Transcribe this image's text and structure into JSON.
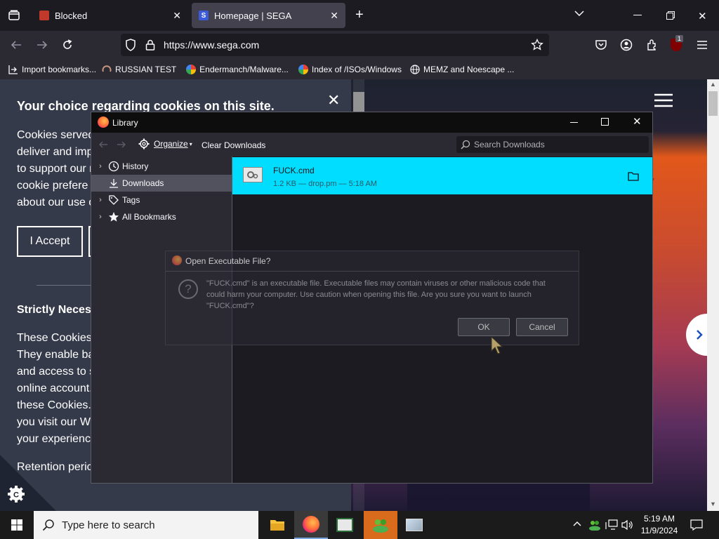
{
  "browser": {
    "tabs": [
      {
        "label": "Blocked",
        "active": false
      },
      {
        "label": "Homepage | SEGA",
        "active": true
      }
    ],
    "url": "https://www.sega.com",
    "extension_badge": "1",
    "bookmarks": [
      {
        "label": "Import bookmarks...",
        "icon": "import-icon"
      },
      {
        "label": "RUSSIAN TEST",
        "icon": "loading-icon"
      },
      {
        "label": "Endermanch/Malware...",
        "icon": "google-icon"
      },
      {
        "label": "Index of /ISOs/Windows",
        "icon": "google-icon"
      },
      {
        "label": "MEMZ and Noescape ...",
        "icon": "globe-icon"
      }
    ]
  },
  "cookie_banner": {
    "heading": "Your choice regarding cookies on this site.",
    "body_lines": [
      "Cookies served",
      "deliver and imp",
      "to support our n",
      "cookie prefere",
      "about our use o"
    ],
    "accept_label": "I Accept",
    "section_heading": "Strictly Neces",
    "section_lines": [
      "These Cookies",
      "They enable ba",
      "and access to s",
      "online account.",
      "these Cookies.",
      "you visit our W",
      "your experienc"
    ],
    "retention": "Retention peric"
  },
  "library": {
    "title": "Library",
    "toolbar": {
      "organize": "Organize",
      "clear": "Clear Downloads",
      "search_placeholder": "Search Downloads"
    },
    "tree": [
      {
        "label": "History",
        "icon": "clock-icon",
        "expandable": true
      },
      {
        "label": "Downloads",
        "icon": "download-icon",
        "expandable": false,
        "selected": true
      },
      {
        "label": "Tags",
        "icon": "tag-icon",
        "expandable": true
      },
      {
        "label": "All Bookmarks",
        "icon": "star-icon",
        "expandable": true
      }
    ],
    "download": {
      "filename": "FUCK.cmd",
      "meta": "1.2 KB — drop.pm — 5:18 AM"
    }
  },
  "dialog": {
    "title": "Open Executable File?",
    "line1": "\"FUCK.cmd\" is an executable file. Executable files may contain viruses or other malicious code that",
    "line2": "could harm your computer. Use caution when opening this file. Are you sure you want to launch",
    "line3": "\"FUCK.cmd\"?",
    "ok": "OK",
    "cancel": "Cancel"
  },
  "taskbar": {
    "search_placeholder": "Type here to search",
    "time": "5:19 AM",
    "date": "11/9/2024"
  },
  "colors": {
    "accent_cyan": "#00ddff",
    "page_bg": "#353a4b",
    "firefox_dark": "#1c1b22",
    "toolbar": "#2b2a33"
  }
}
